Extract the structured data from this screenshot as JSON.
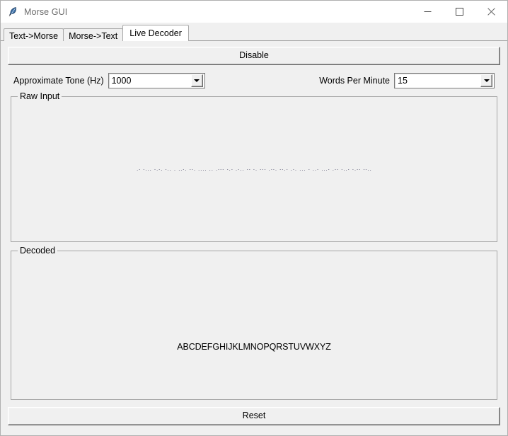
{
  "window": {
    "title": "Morse GUI",
    "icon": "feather-icon",
    "controls": {
      "minimize": "minimize-icon",
      "maximize": "maximize-icon",
      "close": "close-icon"
    }
  },
  "tabs": [
    {
      "label": "Text->Morse",
      "active": false
    },
    {
      "label": "Morse->Text",
      "active": false
    },
    {
      "label": "Live Decoder",
      "active": true
    }
  ],
  "toolbar": {
    "toggle_label": "Disable"
  },
  "options": {
    "tone": {
      "label": "Approximate Tone (Hz)",
      "value": "1000",
      "arrow": "chevron-down-icon"
    },
    "wpm": {
      "label": "Words Per Minute",
      "value": "15",
      "arrow": "chevron-down-icon"
    }
  },
  "raw_input": {
    "title": "Raw Input",
    "text": ".- -... -.-. -.. . ..-. --. .... .. .--- -.- .-.. -- -. --- .--. --.- .-. ... - ..- ...- .-- -..- -.-- --.."
  },
  "decoded": {
    "title": "Decoded",
    "text": "ABCDEFGHIJKLMNOPQRSTUVWXYZ"
  },
  "footer": {
    "reset_label": "Reset"
  },
  "colors": {
    "window_bg": "#f0f0f0",
    "titlebar_bg": "#ffffff",
    "title_fg": "#6d6d6d",
    "groupbox_border": "#a6a6a6",
    "raw_text": "#15143a"
  }
}
